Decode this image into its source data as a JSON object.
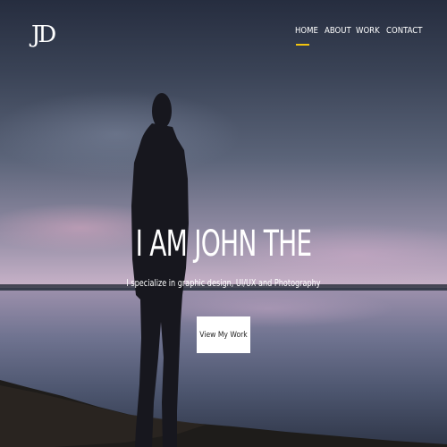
{
  "header": {
    "logo": "JD",
    "nav": [
      {
        "label": "HOME",
        "active": true
      },
      {
        "label": "ABOUT",
        "active": false
      },
      {
        "label": "WORK",
        "active": false
      },
      {
        "label": "CONTACT",
        "active": false
      }
    ]
  },
  "hero": {
    "title": "I AM JOHN THE",
    "subtitle": "I specialize in graphic design, UI/UX and Photography",
    "cta_label": "View My Work"
  },
  "colors": {
    "accent": "#f2c40f",
    "text": "#ffffff",
    "button_bg": "#ffffff",
    "button_text": "#222222"
  }
}
